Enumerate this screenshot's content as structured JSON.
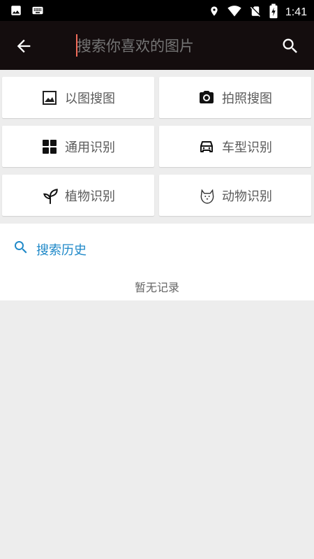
{
  "status_bar": {
    "time": "1:41",
    "icons": [
      "image-notification-icon",
      "keyboard-icon",
      "location-icon",
      "wifi-icon",
      "no-sim-icon",
      "battery-charging-icon"
    ]
  },
  "app_bar": {
    "search": {
      "placeholder": "搜索你喜欢的图片",
      "value": ""
    },
    "icons": [
      "back-arrow-icon",
      "search-icon"
    ]
  },
  "tiles": [
    {
      "label": "以图搜图",
      "icon": "image-icon"
    },
    {
      "label": "拍照搜图",
      "icon": "camera-icon"
    },
    {
      "label": "通用识别",
      "icon": "grid-apps-icon"
    },
    {
      "label": "车型识别",
      "icon": "car-icon"
    },
    {
      "label": "植物识别",
      "icon": "sprout-icon"
    },
    {
      "label": "动物识别",
      "icon": "dog-icon"
    }
  ],
  "history": {
    "title": "搜索历史",
    "empty_text": "暂无记录"
  },
  "colors": {
    "app_bar_bg": "#140d0e",
    "accent": "#1e88c8",
    "page_bg": "#ededed",
    "caret": "#f26c5a"
  }
}
